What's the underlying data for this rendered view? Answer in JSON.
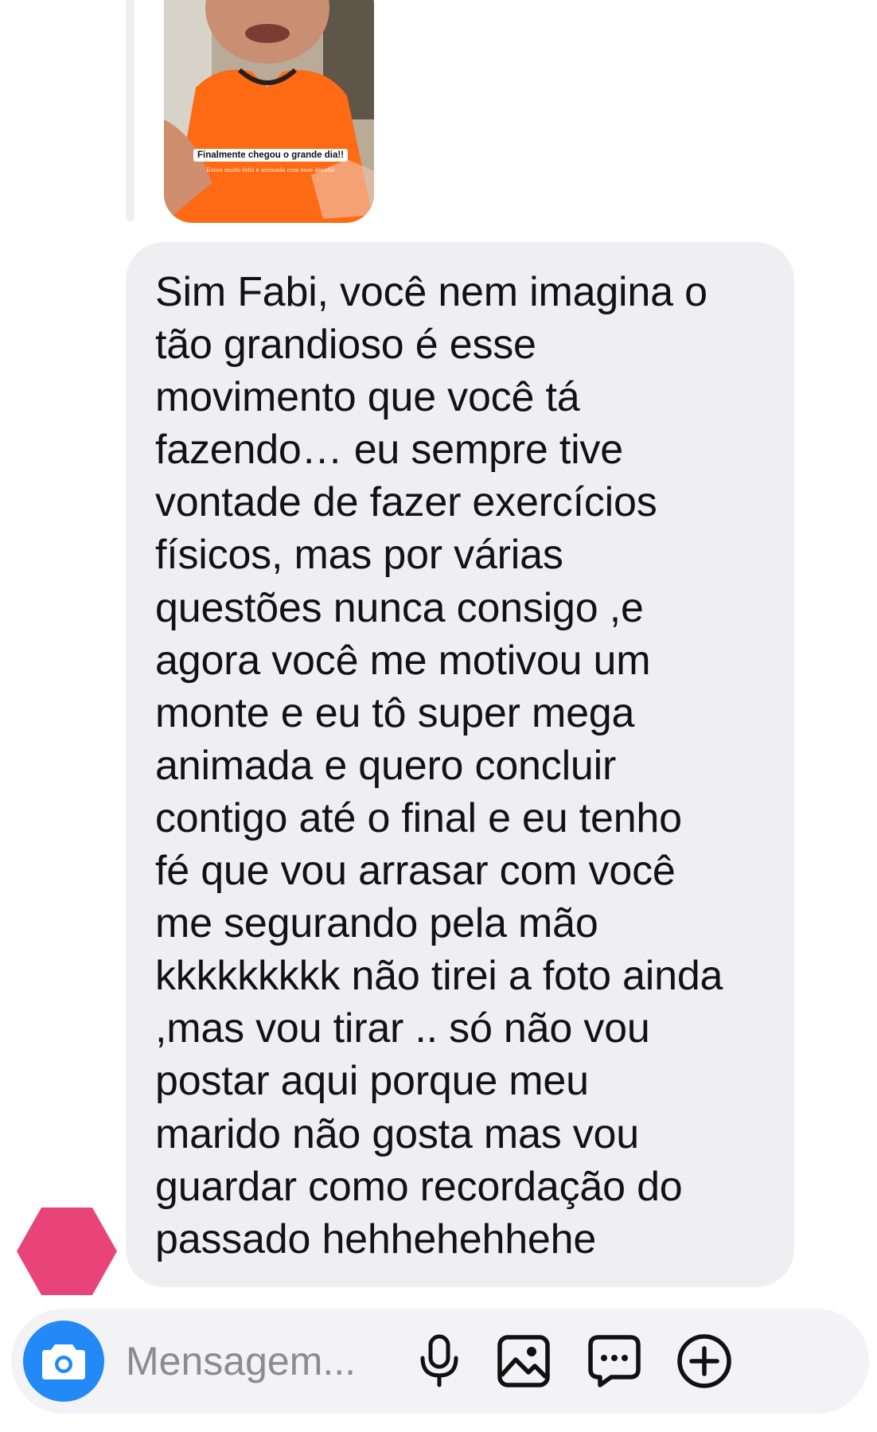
{
  "story_reply": {
    "caption_title": "Finalmente chegou o grande dia!!",
    "caption_subtitle": "Estou muito feliz e animada com esse desafio"
  },
  "message": {
    "text": "Sim Fabi, você nem imagina o\ntão grandioso é esse\nmovimento que você tá\nfazendo… eu sempre tive\nvontade de fazer exercícios\nfísicos, mas por várias\nquestões nunca consigo ,e\nagora você me motivou um\nmonte e eu tô super mega\nanimada e quero concluir\ncontigo até o final e eu tenho\nfé que vou arrasar com você\nme segurando pela mão\nkkkkkkkkk não tirei a foto ainda\n,mas vou tirar .. só não vou\npostar aqui porque meu\nmarido não gosta mas vou\nguardar como recordação do\npassado hehhehehhehe"
  },
  "composer": {
    "placeholder": "Mensagem...",
    "icons": [
      "camera-icon",
      "microphone-icon",
      "image-icon",
      "sticker-icon",
      "plus-icon"
    ]
  },
  "colors": {
    "accent": "#2389f7",
    "bubble": "#efeff2",
    "avatar": "#e84479"
  }
}
